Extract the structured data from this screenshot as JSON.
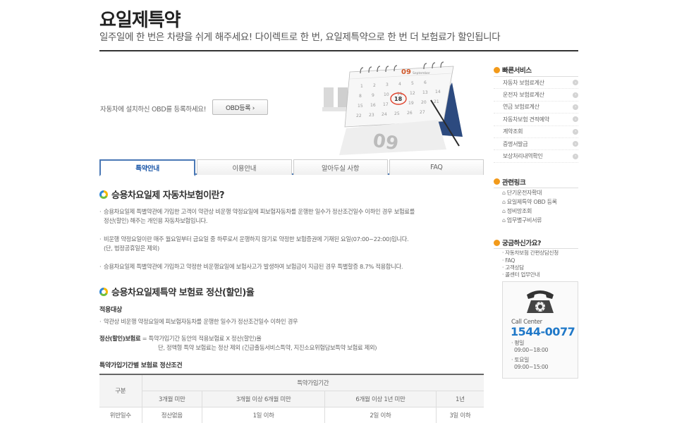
{
  "header": {
    "title": "요일제특약",
    "subtitle": "일주일에 한 번은 차량을 쉬게 해주세요! 다이렉트로 한 번, 요일제특약으로 한 번 더 보험료가 할인됩니다"
  },
  "hero": {
    "text": "자동차에 설치하신 OBD를 등록하세요!",
    "obd_button": "OBD등록 ›",
    "calendar_month_day": "09",
    "calendar_month_name": "September",
    "calendar_highlight": "18",
    "calendar_flip_number": "09"
  },
  "tabs": [
    {
      "label": "특약안내",
      "active": true
    },
    {
      "label": "이용안내",
      "active": false
    },
    {
      "label": "알아두실 사항",
      "active": false
    },
    {
      "label": "FAQ",
      "active": false
    }
  ],
  "section1": {
    "title": "승용차요일제 자동차보험이란?",
    "p1_line1": "승용차요일제 특별약관에 가입한 고객이 약관상 비운행 약정요일에 피보험자동차를 운행한 일수가 정산조건일수 이하인 경우 보험료를",
    "p1_line2": "정산(할인) 해주는 개인용 자동차보험입니다.",
    "p2_line1": "비운행 약정요일이란 매주 월요일부터 금요일 중 하루로서 운행하지 않기로 약정한 보험증권에 기재된 요일(07:00~22:00)입니다.",
    "p2_line2": "(단, 법정공휴일은 제외)",
    "p3_line1": "승용차요일제 특별약관에 가입하고 약정한 비운행요일에 보험사고가 발생하여 보험금이 지급된 경우 특별할증 8.7% 적용합니다."
  },
  "section2": {
    "title": "승용차요일제특약 보험료 정산(할인)율",
    "target_head": "적용대상",
    "target_text": "약관상 비운행 약정요일에 피보험자동차를 운행한 일수가 정산조건일수 이하인 경우",
    "formula_label": "정산(할인)보험료",
    "formula_text": " = 특약가입기간 동안의 적용보험료 X 정산(할인)율",
    "formula_note": "단, 정액형 특약 보험료는 정산 제외 (긴급출동서비스특약, 지진소요위험담보특약 보험료 제외)",
    "table_title": "특약가입기간별 보험료 정산조건",
    "table": {
      "corner": "구분",
      "group_header": "특약가입기간",
      "columns": [
        "3개월 미만",
        "3개월 이상 6개월 미만",
        "6개월 이상 1년 미만",
        "1년"
      ],
      "rows": [
        {
          "label": "위반일수",
          "cells": [
            "정산없음",
            "1일 이하",
            "2일 이하",
            "3일 이하"
          ]
        }
      ]
    }
  },
  "sidebar": {
    "quick_title": "빠른서비스",
    "quick_items": [
      "자동차 보험료계산",
      "운전자 보험료계산",
      "연금 보험료계산",
      "자동차보험 견적예약",
      "계약조회",
      "증명서발급",
      "보상처리내역확인"
    ],
    "links_title": "관련링크",
    "links": [
      "단기운전자확대",
      "요일제특약 OBD 등록",
      "정비망조회",
      "업무별구비서류"
    ],
    "help_title": "궁금하신가요?",
    "help_items": [
      "자동차보험 간편상담신청",
      "FAQ",
      "고객상담",
      "콜센터 업무안내"
    ],
    "callcenter": {
      "label": "Call Center",
      "number": "1544-0077",
      "weekday_label": "· 평일",
      "weekday_hours": "09:00~18:00",
      "saturday_label": "· 토요일",
      "saturday_hours": "09:00~15:00"
    }
  }
}
